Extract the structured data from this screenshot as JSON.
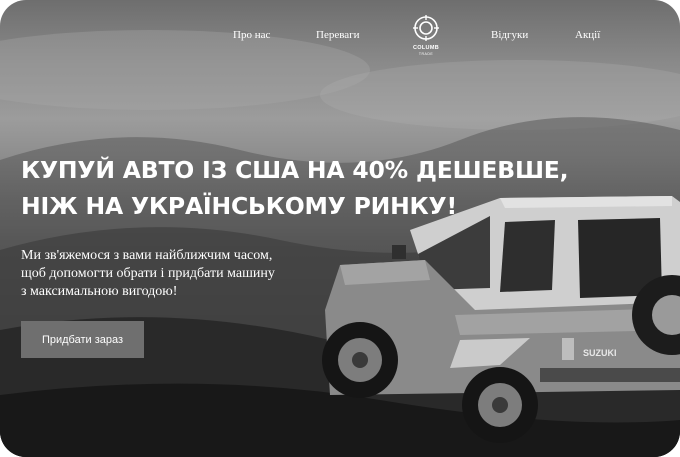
{
  "nav": {
    "items": [
      {
        "label": "Про нас"
      },
      {
        "label": "Переваги"
      },
      {
        "label": "Відгуки"
      },
      {
        "label": "Акції"
      }
    ],
    "logo": {
      "name": "COLUMB",
      "tagline": "TRADE",
      "icon": "columb-logo-icon"
    }
  },
  "hero": {
    "headline_line1": "КУПУЙ АВТО ІЗ США НА 40% ДЕШЕВШЕ,",
    "headline_line2": "НІЖ НА УКРАЇНСЬКОМУ РИНКУ!",
    "sub_line1": "Ми зв'яжемося з вами найближчим часом,",
    "sub_line2": "щоб допомогти обрати і придбати машину",
    "sub_line3": "з максимальною вигодою!",
    "cta_label": "Придбати зараз",
    "vehicle_badge": "SUZUKI"
  },
  "colors": {
    "text": "#ffffff",
    "button_bg": "#6f6f6f"
  }
}
